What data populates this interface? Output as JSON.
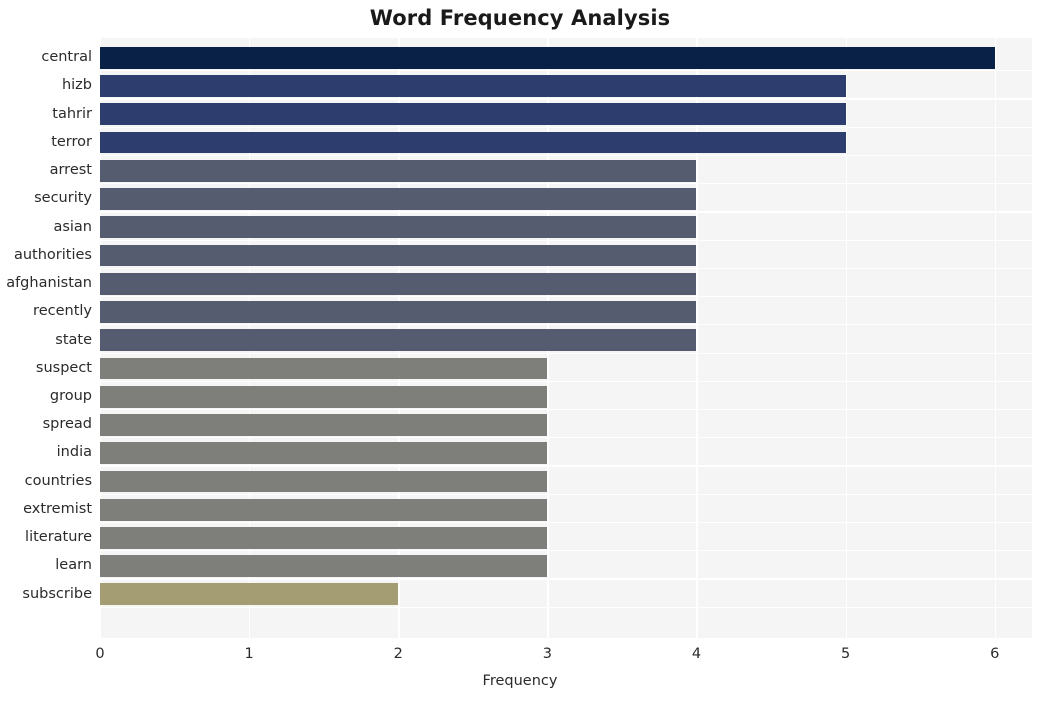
{
  "chart_data": {
    "type": "bar",
    "orientation": "horizontal",
    "title": "Word Frequency Analysis",
    "xlabel": "Frequency",
    "ylabel": "",
    "xlim": [
      0,
      6.25
    ],
    "xticks": [
      0,
      1,
      2,
      3,
      4,
      5,
      6
    ],
    "xtick_labels": [
      "0",
      "1",
      "2",
      "3",
      "4",
      "5",
      "6"
    ],
    "grid": "vertical",
    "legend": "none",
    "categories": [
      "central",
      "hizb",
      "tahrir",
      "terror",
      "arrest",
      "security",
      "asian",
      "authorities",
      "afghanistan",
      "recently",
      "state",
      "suspect",
      "group",
      "spread",
      "india",
      "countries",
      "extremist",
      "literature",
      "learn",
      "subscribe"
    ],
    "values": [
      6,
      5,
      5,
      5,
      4,
      4,
      4,
      4,
      4,
      4,
      4,
      3,
      3,
      3,
      3,
      3,
      3,
      3,
      3,
      2
    ],
    "bar_colors": [
      "#0a2147",
      "#2d3e6e",
      "#2d3e6e",
      "#2d3e6e",
      "#565c70",
      "#565c70",
      "#565c70",
      "#565c70",
      "#565c70",
      "#565c70",
      "#565c70",
      "#7e7e7a",
      "#7e7e7a",
      "#7e7e7a",
      "#7e7e7a",
      "#7e7e7a",
      "#7e7e7a",
      "#7e7e7a",
      "#7e7e7a",
      "#a49c72"
    ],
    "plot_background": "#f5f5f6",
    "grid_color": "#ffffff",
    "figure_background": "#ffffff"
  }
}
